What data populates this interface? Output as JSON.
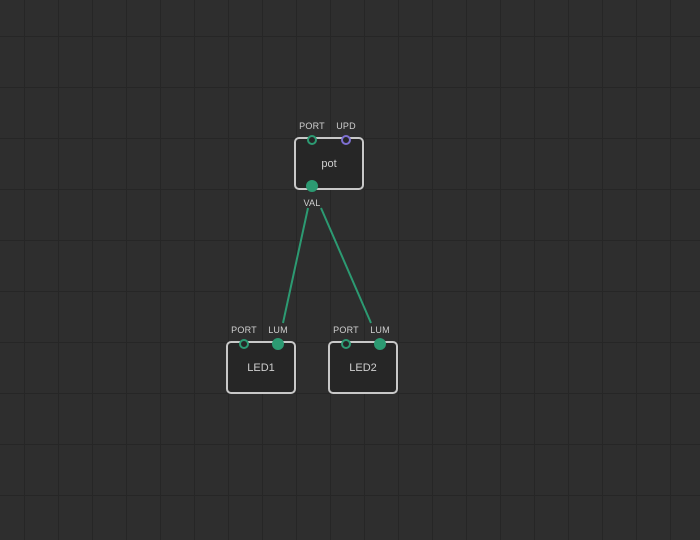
{
  "patch": {
    "nodes": [
      {
        "label": "pot",
        "inputs": [
          {
            "label": "PORT",
            "kind": "value",
            "connected": false
          },
          {
            "label": "UPD",
            "kind": "pulse",
            "connected": false
          }
        ],
        "outputs": [
          {
            "label": "VAL",
            "kind": "value",
            "connected": true
          }
        ]
      },
      {
        "label": "LED1",
        "inputs": [
          {
            "label": "PORT",
            "kind": "value",
            "connected": false
          },
          {
            "label": "LUM",
            "kind": "value",
            "connected": true
          }
        ]
      },
      {
        "label": "LED2",
        "inputs": [
          {
            "label": "PORT",
            "kind": "value",
            "connected": false
          },
          {
            "label": "LUM",
            "kind": "value",
            "connected": true
          }
        ]
      }
    ],
    "links": [
      {
        "from": "pot.VAL",
        "to": "LED1.LUM"
      },
      {
        "from": "pot.VAL",
        "to": "LED2.LUM"
      }
    ]
  },
  "colors": {
    "background": "#2e2e2e",
    "grid_line": "#262626",
    "node_border": "#c8c8c8",
    "node_fill": "#262626",
    "value_pin": "#2c9a72",
    "pulse_pin": "#7d6fd0",
    "link": "#2c9a72"
  }
}
